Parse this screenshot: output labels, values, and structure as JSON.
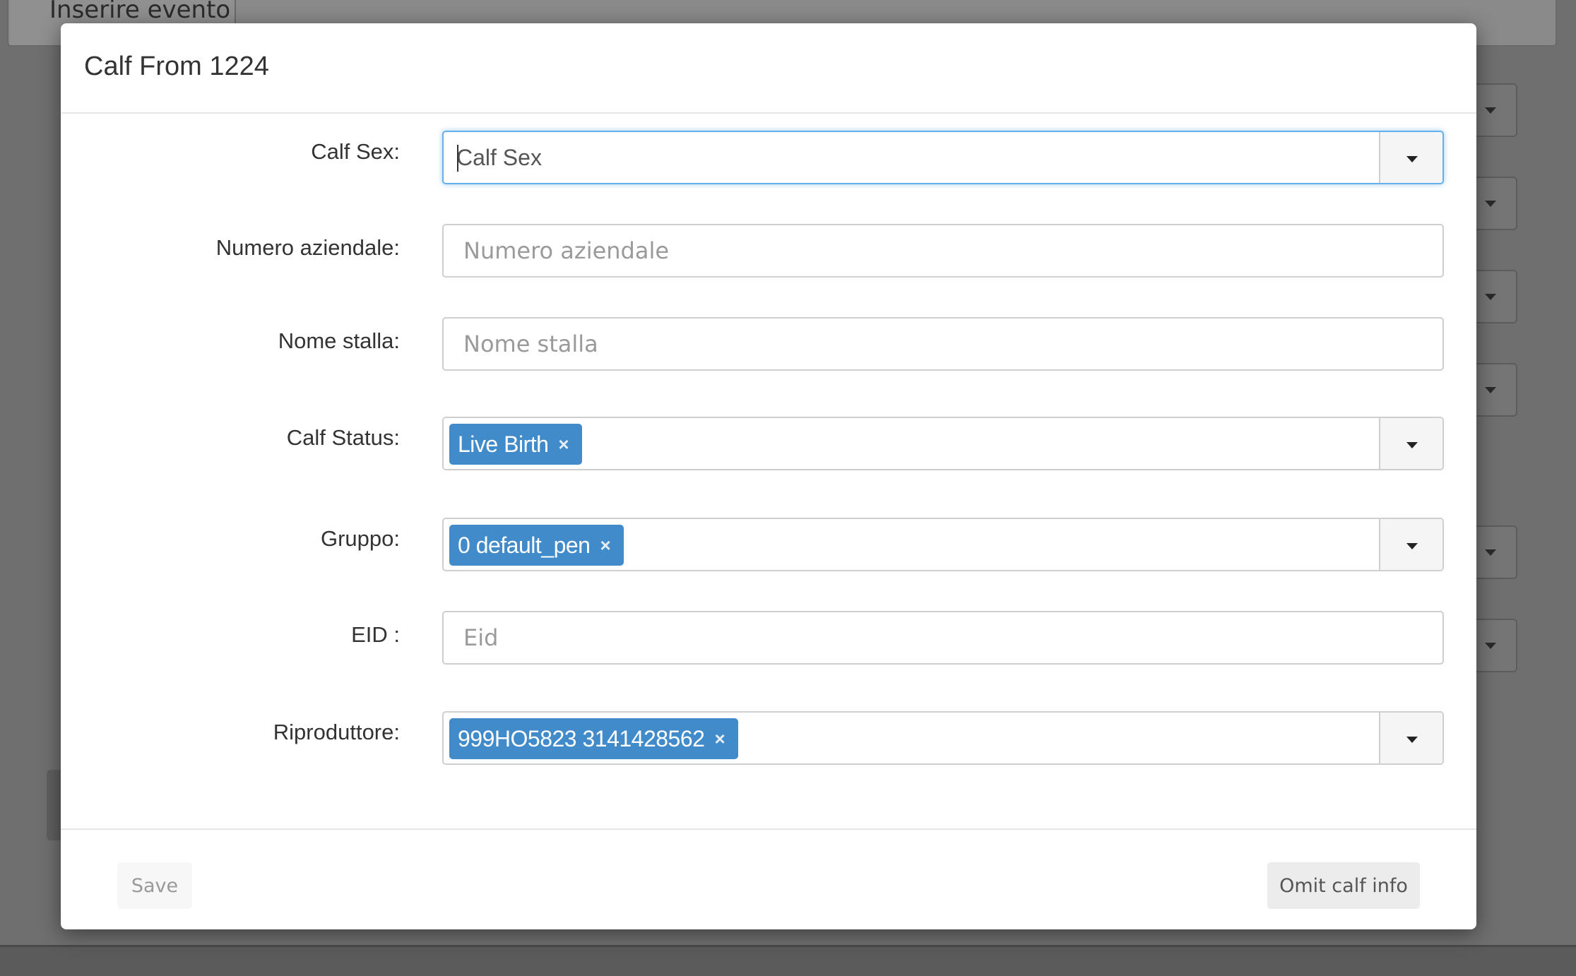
{
  "background": {
    "header_tab_label": "Inserire evento"
  },
  "modal": {
    "title": "Calf From 1224",
    "fields": {
      "calf_sex": {
        "label": "Calf Sex:",
        "placeholder": "Calf Sex"
      },
      "numero_aziendale": {
        "label": "Numero aziendale:",
        "placeholder": "Numero aziendale"
      },
      "nome_stalla": {
        "label": "Nome stalla:",
        "placeholder": "Nome stalla"
      },
      "calf_status": {
        "label": "Calf Status:",
        "selected": "Live Birth"
      },
      "gruppo": {
        "label": "Gruppo:",
        "selected": "0 default_pen"
      },
      "eid": {
        "label": "EID :",
        "placeholder": "Eid"
      },
      "riproduttore": {
        "label": "Riproduttore:",
        "selected": "999HO5823 3141428562"
      }
    },
    "footer": {
      "save_label": "Save",
      "omit_label": "Omit calf info"
    }
  },
  "icons": {
    "remove_tag": "×",
    "dropdown": "caret-down-icon"
  },
  "colors": {
    "tag_bg": "#428bca",
    "focus_border": "#66afe9",
    "backdrop": "#6f6f6f"
  }
}
